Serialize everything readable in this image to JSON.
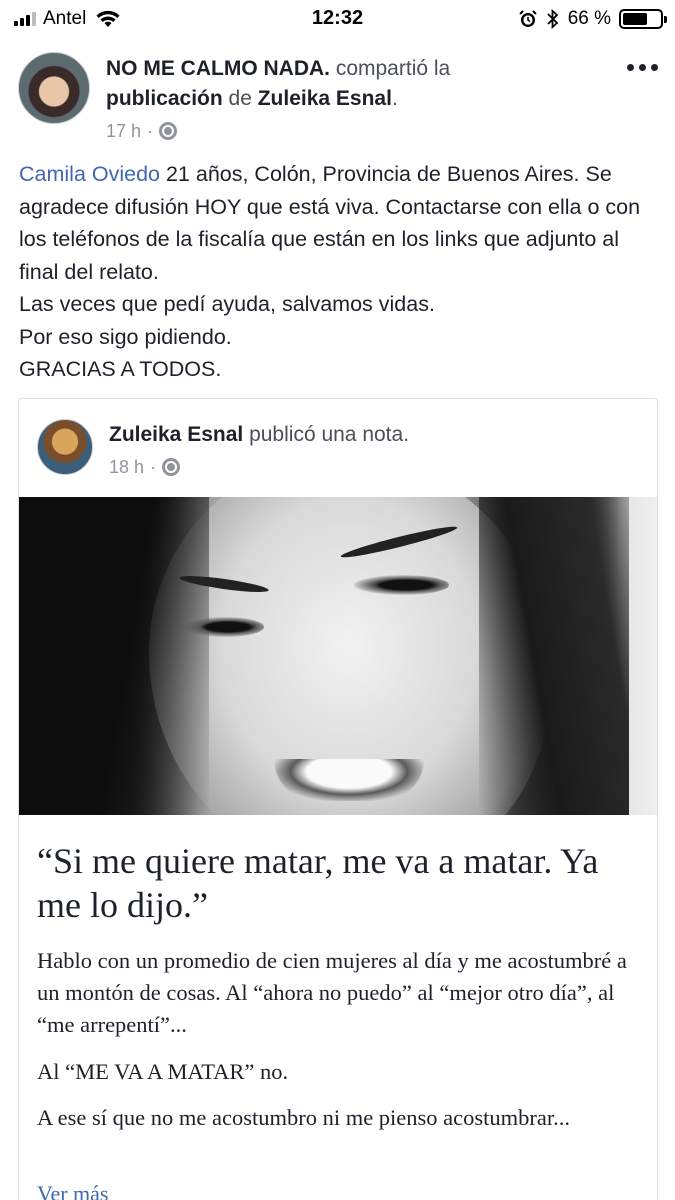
{
  "status_bar": {
    "carrier": "Antel",
    "time": "12:32",
    "battery_percent": "66 %",
    "battery_level": 0.66,
    "signal_bars": 3,
    "icons": [
      "signal-icon",
      "wifi-icon",
      "alarm-icon",
      "bluetooth-icon",
      "battery-icon"
    ]
  },
  "post": {
    "author": "NO ME CALMO NADA.",
    "action_1": " compartió la ",
    "shared_object": "publicación",
    "action_2": " de ",
    "original_author": "Zuleika Esnal",
    "action_end": ".",
    "time": "17 h",
    "privacy_icon": "globe-icon",
    "body": {
      "mention": "Camila Oviedo",
      "line1_rest": " 21 años, Colón, Provincia de Buenos Aires. Se agradece difusión HOY que está viva. Contactarse con ella o con los teléfonos de la fiscalía que están en los links que adjunto al final del relato.",
      "line2": "Las veces que pedí ayuda, salvamos vidas.",
      "line3": "Por eso sigo pidiendo.",
      "line4": "GRACIAS A TODOS."
    }
  },
  "shared_card": {
    "author": "Zuleika Esnal",
    "action": " publicó una nota.",
    "time": "18 h",
    "note_title": "“Si me quiere matar, me va a matar. Ya me lo dijo.”",
    "paragraphs": [
      "Hablo con un promedio de cien mujeres al día y me acostumbré a un montón de cosas. Al “ahora no puedo” al “mejor otro día”, al “me arrepentí”...",
      "Al “ME VA A MATAR” no.",
      "A ese sí que no me acostumbro ni me pienso acostumbrar..."
    ],
    "see_more": "Ver más"
  }
}
